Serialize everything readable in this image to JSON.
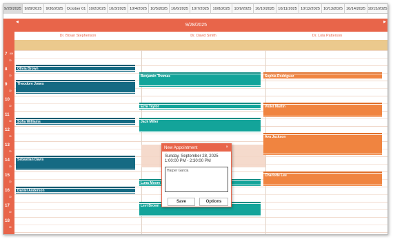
{
  "date_tabs": [
    "9/28/2025",
    "9/29/2025",
    "9/30/2025",
    "October 01",
    "10/2/2025",
    "10/3/2025",
    "10/4/2025",
    "10/5/2025",
    "10/6/2025",
    "10/7/2025",
    "10/8/2025",
    "10/9/2025",
    "10/10/2025",
    "10/11/2025",
    "10/12/2025",
    "10/13/2025",
    "10/14/2025",
    "10/15/2025"
  ],
  "header": {
    "title": "9/28/2025",
    "prev_arrow": "◀",
    "next_arrow": "▶"
  },
  "resources": [
    "Dr. Bryan Stephenson",
    "Dr. David Smith",
    "Dr. Lola Patterson"
  ],
  "hours": [
    "7",
    "8",
    "9",
    "10",
    "11",
    "12",
    "13",
    "14",
    "15",
    "16",
    "17",
    "18"
  ],
  "ampm_label": "AM",
  "half_label": "30",
  "appointments": {
    "olivia": "Olivia Brown",
    "theodore": "Theodore Jones",
    "sofia": "Sofia Williams",
    "sebastian": "Sebastian Davis",
    "daniel": "Daniel Anderson",
    "benjamin": "Benjamin Thomas",
    "ezra": "Ezra Taylor",
    "jack": "Jack Miller",
    "luna": "Luna Moore",
    "levi": "Levi Brown",
    "sophia": "Sophia Rodriguez",
    "violet": "Violet Martin",
    "ava": "Ava Jackson",
    "charlotte": "Charlotte Lee"
  },
  "dialog": {
    "title": "New Appointment",
    "close": "×",
    "date_line": "Sunday, September 28, 2025",
    "time_line": "1:00:00 PM - 2:30:00 PM",
    "name_value": "Harper Garcia",
    "save_label": "Save",
    "options_label": "Options"
  },
  "colors": {
    "accent": "#e8654a",
    "allday": "#ebc98d",
    "blue": "#156a83",
    "teal": "#13a49a",
    "orange": "#f08440"
  }
}
